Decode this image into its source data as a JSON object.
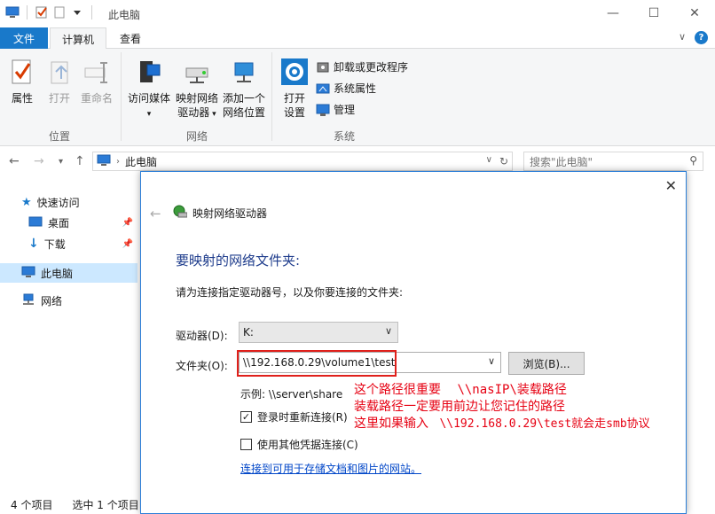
{
  "window": {
    "title": "此电脑"
  },
  "ribbon_tabs": {
    "file": "文件",
    "computer": "计算机",
    "view": "查看"
  },
  "ribbon": {
    "location_group": {
      "label": "位置",
      "properties": "属性",
      "open": "打开",
      "rename": "重命名"
    },
    "network_group": {
      "label": "网络",
      "media": "访问媒体",
      "map_line1": "映射网络",
      "map_line2": "驱动器",
      "add_line1": "添加一个",
      "add_line2": "网络位置"
    },
    "system_group": {
      "label": "系统",
      "open_settings_line1": "打开",
      "open_settings_line2": "设置",
      "uninstall": "卸载或更改程序",
      "sys_props": "系统属性",
      "manage": "管理"
    }
  },
  "addressbar": {
    "path": "此电脑",
    "search_placeholder": "搜索\"此电脑\""
  },
  "nav": {
    "quick_access": "快速访问",
    "desktop": "桌面",
    "downloads": "下载",
    "this_pc": "此电脑",
    "network": "网络"
  },
  "status": {
    "items": "4 个项目",
    "selected": "选中 1 个项目"
  },
  "dialog": {
    "title": "映射网络驱动器",
    "heading": "要映射的网络文件夹:",
    "instruction": "请为连接指定驱动器号，以及你要连接的文件夹:",
    "drive_label": "驱动器(D):",
    "drive_value": "K:",
    "folder_label": "文件夹(O):",
    "folder_value": "\\\\192.168.0.29\\volume1\\test",
    "browse": "浏览(B)...",
    "example": "示例: \\\\server\\share",
    "reconnect": "登录时重新连接(R)",
    "reconnect_checked": true,
    "other_creds": "使用其他凭据连接(C)",
    "link": "连接到可用于存储文档和图片的网站。"
  },
  "annotations": {
    "line1_a": "这个路径很重要",
    "line1_b": "\\\\nasIP\\装载路径",
    "line2": "装载路径一定要用前边让您记住的路径",
    "line3_a": "这里如果输入",
    "line3_b": "\\\\192.168.0.29\\test就会走smb协议"
  },
  "colors": {
    "accent": "#1979ca",
    "annotation": "#e60012",
    "heading": "#1e3c8c"
  }
}
